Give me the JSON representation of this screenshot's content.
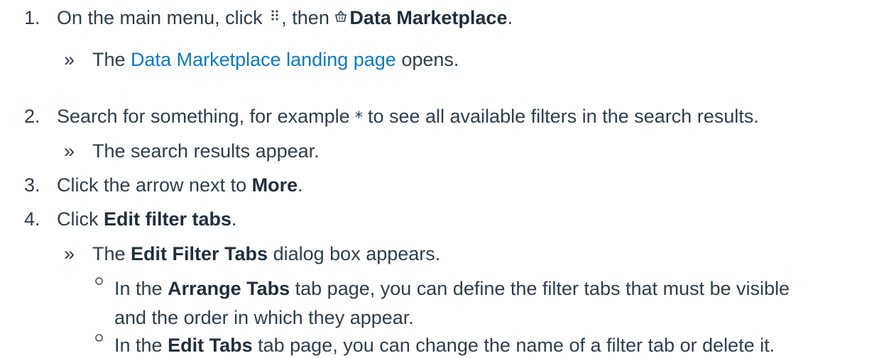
{
  "steps": [
    {
      "num": "1.",
      "pre": "On the main menu, click",
      "grid_icon": "⠿",
      "mid": ", then",
      "basket_icon": "🧺",
      "bold": "Data Marketplace",
      "post": ".",
      "result_pre": "The",
      "result_link": "Data Marketplace landing page",
      "result_post": "opens."
    },
    {
      "num": "2.",
      "pre": "Search for something, for example",
      "code": "*",
      "post": "to see all available filters in the search results.",
      "result": "The search results appear."
    },
    {
      "num": "3.",
      "pre": "Click the arrow next to",
      "bold": "More",
      "post": "."
    },
    {
      "num": "4.",
      "pre": "Click",
      "bold": "Edit filter tabs",
      "post": ".",
      "result_pre": "The",
      "result_bold": "Edit Filter Tabs",
      "result_post": "dialog box appears.",
      "bullets": [
        {
          "pre": "In the",
          "bold": "Arrange Tabs",
          "post": "tab page, you can define the filter tabs that must be visible",
          "cont": "and the order in which they appear."
        },
        {
          "pre": "In the",
          "bold": "Edit Tabs",
          "post": "tab page, you can change the name of a filter tab or delete it."
        }
      ]
    }
  ],
  "result_marker": "»",
  "icons": {
    "menu": "grid-icon",
    "marketplace": "basket-icon"
  }
}
